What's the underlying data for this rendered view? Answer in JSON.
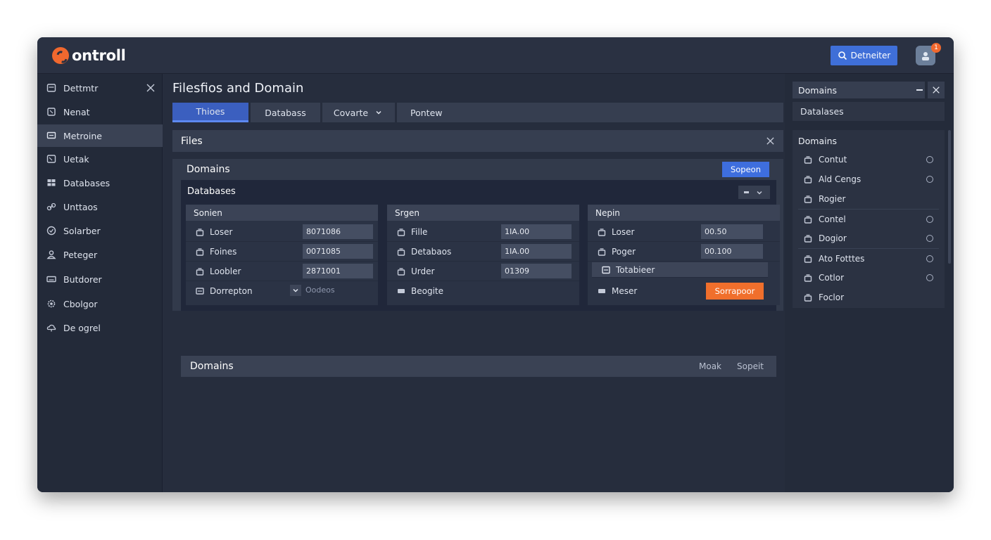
{
  "app": {
    "brand": "ontroll",
    "search_label": "Detneiter",
    "notification_count": "1"
  },
  "sidebar": {
    "items": [
      {
        "label": "Dettmtr",
        "icon": "document-icon"
      },
      {
        "label": "Nenat",
        "icon": "square-icon"
      },
      {
        "label": "Metroine",
        "icon": "monitor-icon",
        "active": true
      },
      {
        "label": "Uetak",
        "icon": "window-icon"
      },
      {
        "label": "Databases",
        "icon": "database-icon"
      },
      {
        "label": "Unttaos",
        "icon": "link-icon"
      },
      {
        "label": "Solarber",
        "icon": "check-circle-icon"
      },
      {
        "label": "Peteger",
        "icon": "user-icon"
      },
      {
        "label": "Butdorer",
        "icon": "keyboard-icon"
      },
      {
        "label": "Cbolgor",
        "icon": "gear-icon"
      },
      {
        "label": "De ogrel",
        "icon": "cloud-icon"
      }
    ]
  },
  "main": {
    "title": "Filesfios and Domain",
    "tabs": [
      {
        "label": "Thioes",
        "active": true
      },
      {
        "label": "Databass"
      },
      {
        "label": "Covarte",
        "has_dropdown": true
      },
      {
        "label": "Pontew"
      }
    ],
    "files_label": "Files",
    "domains_label": "Domains",
    "sopeon_label": "Sopeon",
    "databases_label": "Databases",
    "columns": [
      {
        "header": "Sonien",
        "rows": [
          {
            "label": "Loser",
            "value": "8071086"
          },
          {
            "label": "Foines",
            "value": "0071085"
          },
          {
            "label": "Loobler",
            "value": "2871001"
          },
          {
            "label": "Dorrepton",
            "value": "Oodeos",
            "dropdown": true
          }
        ]
      },
      {
        "header": "Srgen",
        "rows": [
          {
            "label": "Fille",
            "value": "1IA.00"
          },
          {
            "label": "Detabaos",
            "value": "1IA.00"
          },
          {
            "label": "Urder",
            "value": "01309"
          },
          {
            "label": "Beogite",
            "value": ""
          }
        ]
      },
      {
        "header": "Nepin",
        "rows": [
          {
            "label": "Loser",
            "value": "00.50"
          },
          {
            "label": "Poger",
            "value": "00.100"
          },
          {
            "label": "Totabieer",
            "value": "",
            "highlight": true
          },
          {
            "label": "Meser",
            "value": "",
            "button": "Sorrapoor"
          }
        ]
      }
    ],
    "footer": {
      "title": "Domains",
      "link_1": "Moak",
      "link_2": "Sopeit"
    }
  },
  "right_panel": {
    "header": "Domains",
    "sub": "Datalases",
    "list_title": "Domains",
    "items": [
      {
        "label": "Contut",
        "radio": true
      },
      {
        "label": "Ald Cengs",
        "radio": true
      },
      {
        "label": "Rogier",
        "radio": false
      },
      {
        "label": "Contel",
        "radio": true,
        "separator": true
      },
      {
        "label": "Dogior",
        "radio": true
      },
      {
        "label": "Ato Fotttes",
        "radio": true,
        "separator": true
      },
      {
        "label": "Cotlor",
        "radio": true
      },
      {
        "label": "Foclor",
        "radio": false
      }
    ]
  },
  "colors": {
    "accent": "#3f6fd8",
    "orange": "#f06f2c",
    "bg": "#252b3b"
  }
}
